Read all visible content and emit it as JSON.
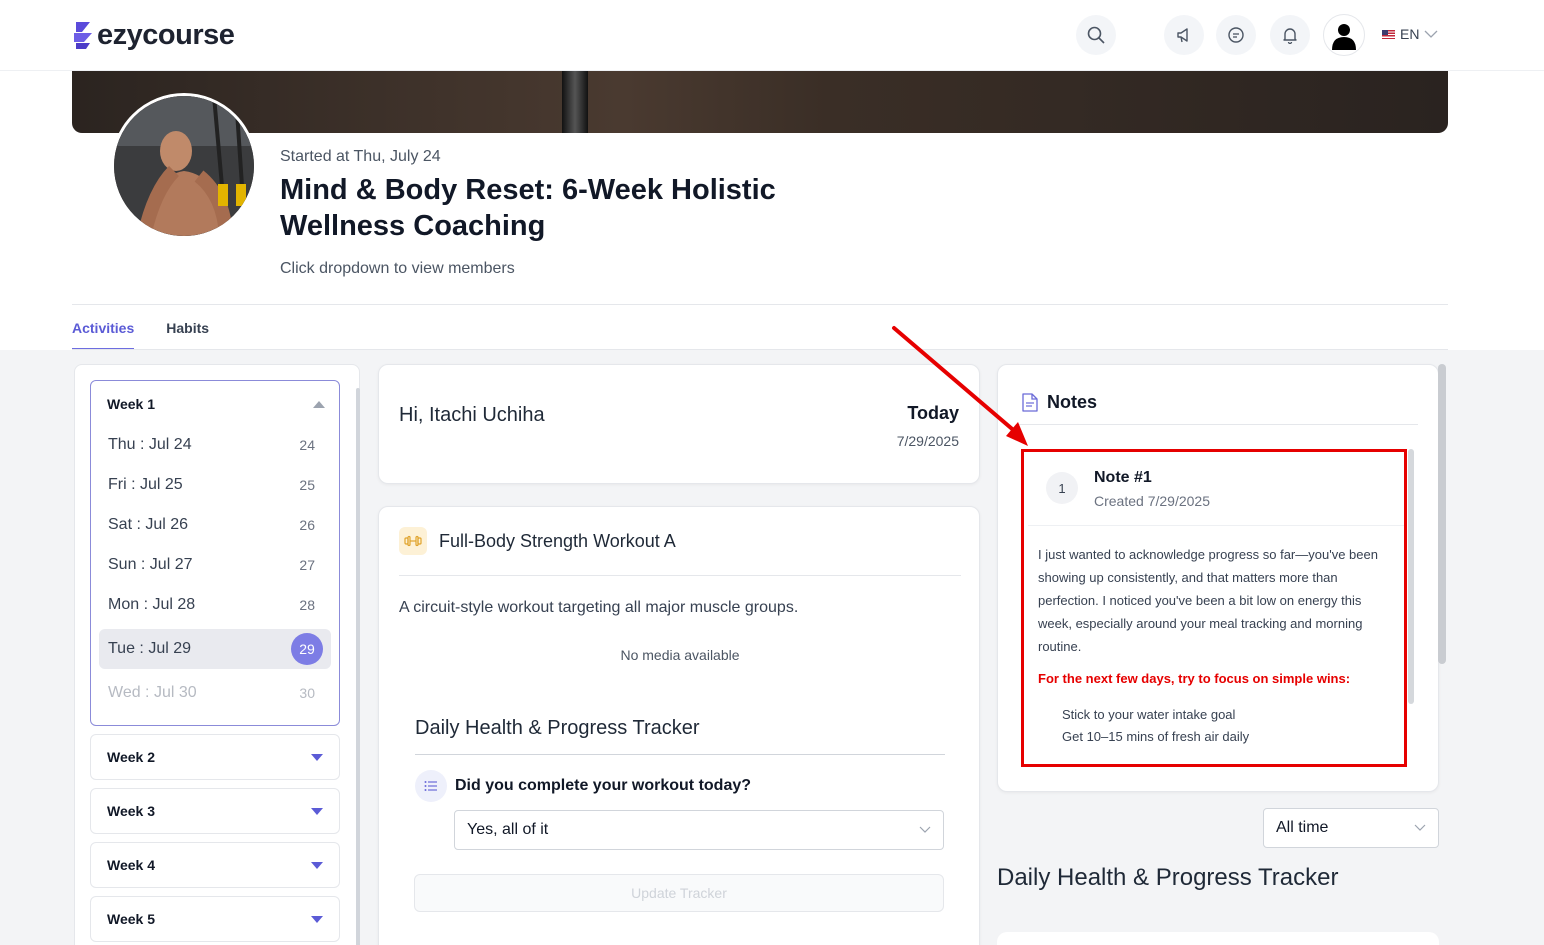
{
  "header": {
    "logo_text": "ezycourse",
    "language": "EN",
    "icons": [
      "search-icon",
      "megaphone-icon",
      "chat-icon",
      "bell-icon",
      "user-avatar-icon",
      "chevron-down-icon"
    ]
  },
  "course": {
    "started": "Started at Thu, July 24",
    "title_line1": "Mind & Body Reset: 6-Week Holistic",
    "title_line2": "Wellness Coaching",
    "members_hint": "Click dropdown to view members"
  },
  "tabs": [
    {
      "label": "Activities",
      "active": true
    },
    {
      "label": "Habits",
      "active": false
    }
  ],
  "weeks": {
    "week1": {
      "label": "Week 1",
      "days": [
        {
          "label": "Thu : Jul 24",
          "num": "24"
        },
        {
          "label": "Fri : Jul 25",
          "num": "25"
        },
        {
          "label": "Sat : Jul 26",
          "num": "26"
        },
        {
          "label": "Sun : Jul 27",
          "num": "27"
        },
        {
          "label": "Mon : Jul 28",
          "num": "28"
        },
        {
          "label": "Tue : Jul 29",
          "num": "29",
          "selected": true
        },
        {
          "label": "Wed : Jul 30",
          "num": "30",
          "disabled": true
        }
      ]
    },
    "collapsed": [
      {
        "label": "Week 2"
      },
      {
        "label": "Week 3"
      },
      {
        "label": "Week 4"
      },
      {
        "label": "Week 5"
      }
    ]
  },
  "greeting": {
    "text": "Hi, Itachi Uchiha",
    "today_label": "Today",
    "date": "7/29/2025"
  },
  "workout": {
    "title": "Full-Body Strength Workout A",
    "description": "A circuit-style workout targeting all major muscle groups.",
    "media": "No media available",
    "tracker_title": "Daily Health & Progress Tracker",
    "question": "Did you complete your workout today?",
    "answer": "Yes, all of it",
    "update_button": "Update Tracker"
  },
  "notes": {
    "heading": "Notes",
    "note": {
      "index": "1",
      "title": "Note #1",
      "created": "Created 7/29/2025",
      "body": "I just wanted to acknowledge progress so far—you've been showing up consistently, and that matters more than perfection. I noticed you've been a bit low on energy this week, especially around your meal tracking and morning routine.",
      "highlight": "For the next few days, try to focus on simple wins:",
      "items": [
        "Stick to your water intake goal",
        "Get 10–15 mins of fresh air daily"
      ]
    },
    "highlight_color": "#e60000"
  },
  "right_panel": {
    "filter": "All time",
    "tracker_title": "Daily Health & Progress Tracker"
  },
  "colors": {
    "accent": "#5b5bd6",
    "selected_day": "#7d7de5",
    "annotation_red": "#e60000"
  }
}
